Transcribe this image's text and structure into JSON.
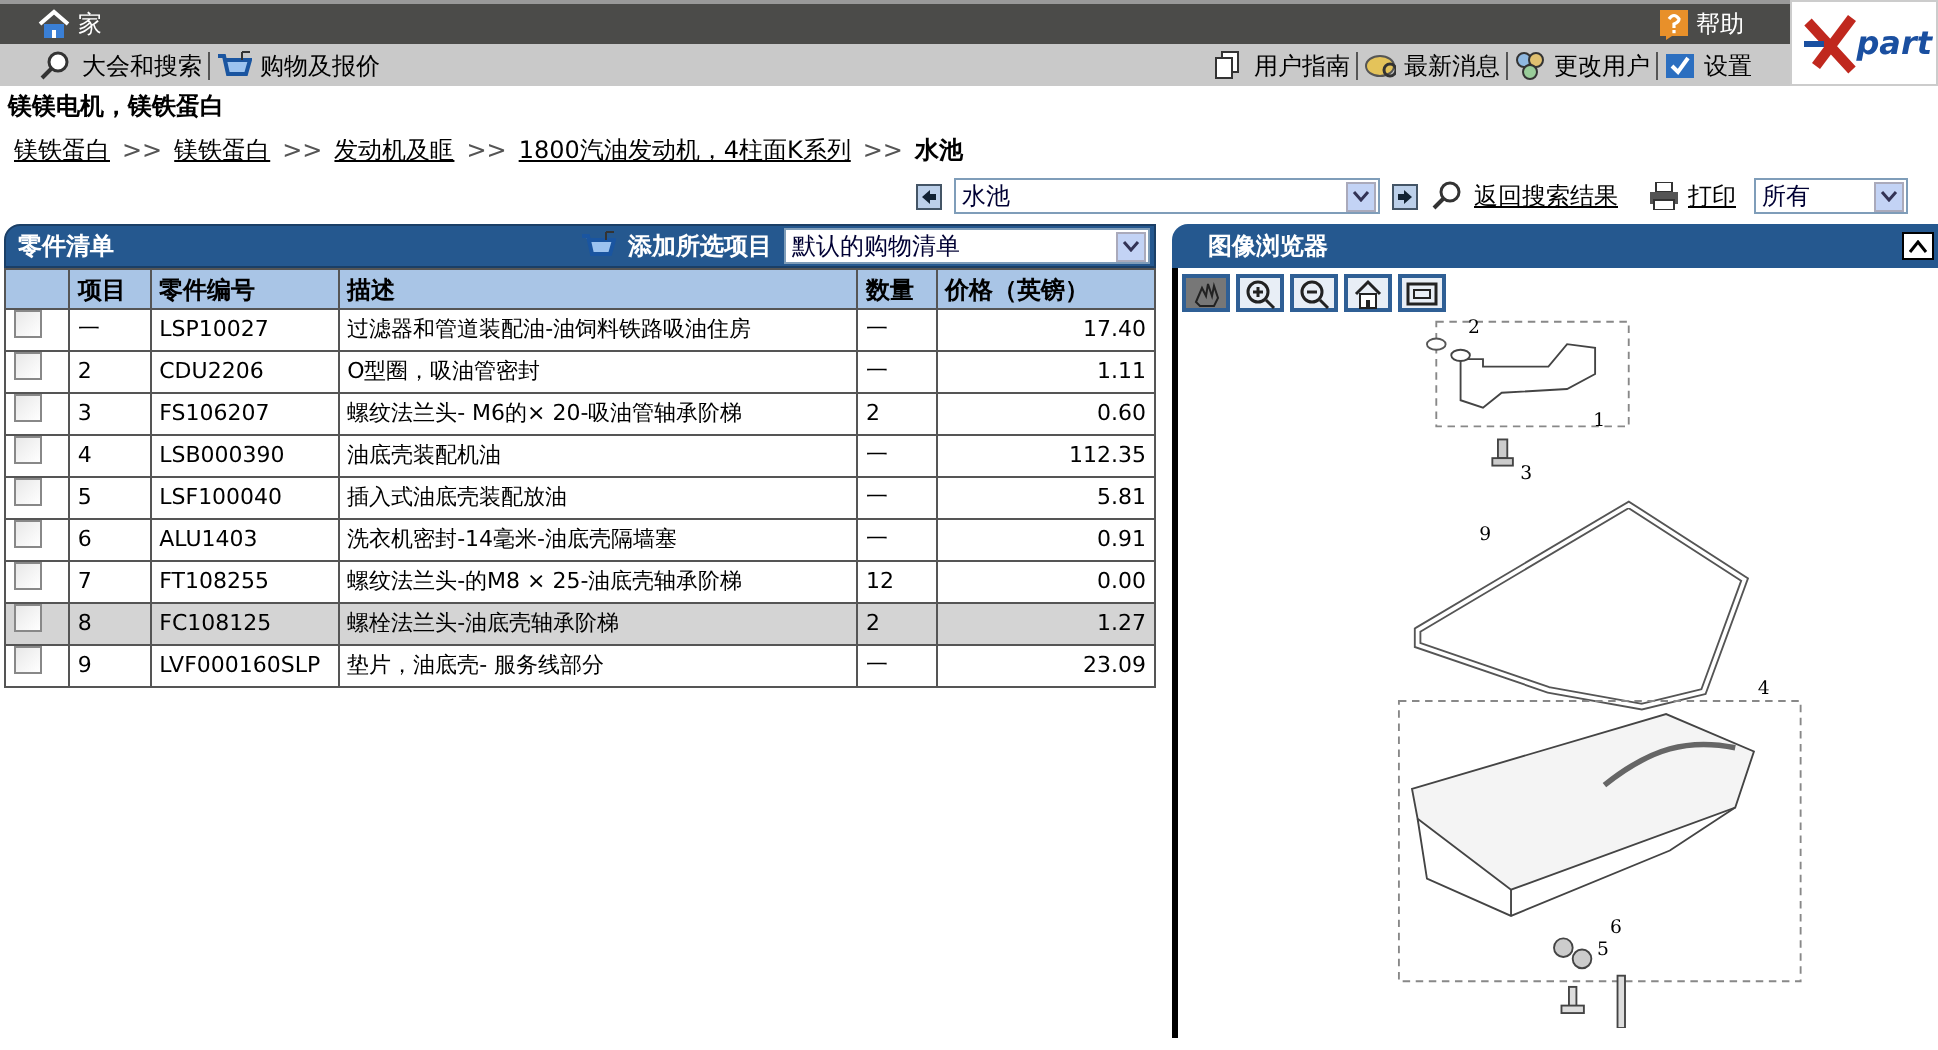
{
  "top_bar": {
    "home": "家",
    "help": "帮助",
    "logo": "part"
  },
  "menu_left": [
    "大会和搜索",
    "购物及报价"
  ],
  "menu_right": [
    "用户指南",
    "最新消息",
    "更改用户",
    "设置"
  ],
  "page_title": "镁镁电机，镁铁蛋白",
  "breadcrumb_separator": ">>",
  "breadcrumb": [
    {
      "label": "镁铁蛋白",
      "link": true
    },
    {
      "label": "镁铁蛋白",
      "link": true
    },
    {
      "label": "发动机及眶",
      "link": true
    },
    {
      "label": "1800汽油发动机，4柱面K系列",
      "link": true
    },
    {
      "label": "水池",
      "link": false
    }
  ],
  "toolbar": {
    "section_select": "水池",
    "back_link": "返回搜索结果",
    "print_link": "打印",
    "filter_select": "所有"
  },
  "parts_panel": {
    "title": "零件清单",
    "add_button": "添加所选项目",
    "list_select": "默认的购物清单",
    "columns": [
      "项目",
      "零件编号",
      "描述",
      "数量",
      "价格（英镑）"
    ],
    "rows": [
      {
        "checked": false,
        "selected": false,
        "cells": [
          "一",
          "LSP10027",
          "过滤器和管道装配油-油饲料铁路吸油住房",
          "一",
          "17.40"
        ]
      },
      {
        "checked": false,
        "selected": false,
        "cells": [
          "2",
          "CDU2206",
          "O型圈，吸油管密封",
          "一",
          "1.11"
        ]
      },
      {
        "checked": false,
        "selected": false,
        "cells": [
          "3",
          "FS106207",
          "螺纹法兰头- M6的× 20-吸油管轴承阶梯",
          "2",
          "0.60"
        ]
      },
      {
        "checked": false,
        "selected": false,
        "cells": [
          "4",
          "LSB000390",
          "油底壳装配机油",
          "一",
          "112.35"
        ]
      },
      {
        "checked": false,
        "selected": false,
        "cells": [
          "5",
          "LSF100040",
          "插入式油底壳装配放油",
          "一",
          "5.81"
        ]
      },
      {
        "checked": false,
        "selected": false,
        "cells": [
          "6",
          "ALU1403",
          "洗衣机密封-14毫米-油底壳隔墙塞",
          "一",
          "0.91"
        ]
      },
      {
        "checked": false,
        "selected": false,
        "cells": [
          "7",
          "FT108255",
          "螺纹法兰头-的M8 × 25-油底壳轴承阶梯",
          "12",
          "0.00"
        ]
      },
      {
        "checked": false,
        "selected": true,
        "cells": [
          "8",
          "FC108125",
          "螺栓法兰头-油底壳轴承阶梯",
          "2",
          "1.27"
        ]
      },
      {
        "checked": false,
        "selected": false,
        "cells": [
          "9",
          "LVF000160SLP",
          "垫片，油底壳- 服务线部分",
          "一",
          "23.09"
        ]
      }
    ]
  },
  "image_viewer": {
    "title": "图像浏览器",
    "tools": [
      {
        "kind": "pan",
        "selected": true
      },
      {
        "kind": "zoom-in",
        "selected": false
      },
      {
        "kind": "zoom-out",
        "selected": false
      },
      {
        "kind": "home",
        "selected": false
      },
      {
        "kind": "fit",
        "selected": false
      }
    ],
    "callouts": [
      "2",
      "1",
      "3",
      "9",
      "4",
      "6",
      "5"
    ]
  }
}
